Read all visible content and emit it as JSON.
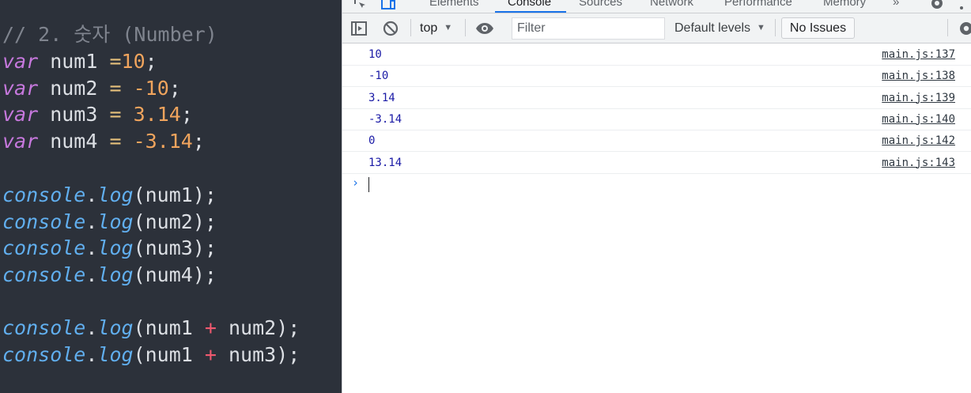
{
  "editor": {
    "lines": [
      {
        "tokens": [
          {
            "t": "comment",
            "v": "// 2. 숫자 (Number)"
          }
        ]
      },
      {
        "tokens": [
          {
            "t": "kw",
            "v": "var"
          },
          {
            "t": "id",
            "v": " num1 "
          },
          {
            "t": "op",
            "v": "="
          },
          {
            "t": "num",
            "v": "10"
          },
          {
            "t": "id",
            "v": ";"
          }
        ]
      },
      {
        "tokens": [
          {
            "t": "kw",
            "v": "var"
          },
          {
            "t": "id",
            "v": " num2 "
          },
          {
            "t": "op",
            "v": "="
          },
          {
            "t": "id",
            "v": " "
          },
          {
            "t": "num",
            "v": "-10"
          },
          {
            "t": "id",
            "v": ";"
          }
        ]
      },
      {
        "tokens": [
          {
            "t": "kw",
            "v": "var"
          },
          {
            "t": "id",
            "v": " num3 "
          },
          {
            "t": "op",
            "v": "="
          },
          {
            "t": "id",
            "v": " "
          },
          {
            "t": "num",
            "v": "3.14"
          },
          {
            "t": "id",
            "v": ";"
          }
        ]
      },
      {
        "tokens": [
          {
            "t": "kw",
            "v": "var"
          },
          {
            "t": "id",
            "v": " num4 "
          },
          {
            "t": "op",
            "v": "="
          },
          {
            "t": "id",
            "v": " "
          },
          {
            "t": "num",
            "v": "-3.14"
          },
          {
            "t": "id",
            "v": ";"
          }
        ]
      },
      {
        "tokens": []
      },
      {
        "tokens": [
          {
            "t": "obj",
            "v": "console"
          },
          {
            "t": "id",
            "v": "."
          },
          {
            "t": "method",
            "v": "log"
          },
          {
            "t": "id",
            "v": "(num1);"
          }
        ]
      },
      {
        "tokens": [
          {
            "t": "obj",
            "v": "console"
          },
          {
            "t": "id",
            "v": "."
          },
          {
            "t": "method",
            "v": "log"
          },
          {
            "t": "id",
            "v": "(num2);"
          }
        ]
      },
      {
        "tokens": [
          {
            "t": "obj",
            "v": "console"
          },
          {
            "t": "id",
            "v": "."
          },
          {
            "t": "method",
            "v": "log"
          },
          {
            "t": "id",
            "v": "(num3);"
          }
        ]
      },
      {
        "tokens": [
          {
            "t": "obj",
            "v": "console"
          },
          {
            "t": "id",
            "v": "."
          },
          {
            "t": "method",
            "v": "log"
          },
          {
            "t": "id",
            "v": "(num4);"
          }
        ]
      },
      {
        "tokens": []
      },
      {
        "tokens": [
          {
            "t": "obj",
            "v": "console"
          },
          {
            "t": "id",
            "v": "."
          },
          {
            "t": "method",
            "v": "log"
          },
          {
            "t": "id",
            "v": "(num1 "
          },
          {
            "t": "op-red",
            "v": "+"
          },
          {
            "t": "id",
            "v": " num2);"
          }
        ]
      },
      {
        "tokens": [
          {
            "t": "obj",
            "v": "console"
          },
          {
            "t": "id",
            "v": "."
          },
          {
            "t": "method",
            "v": "log"
          },
          {
            "t": "id",
            "v": "(num1 "
          },
          {
            "t": "op-red",
            "v": "+"
          },
          {
            "t": "id",
            "v": " num3);"
          }
        ]
      }
    ]
  },
  "devtools": {
    "tabs": [
      {
        "label": "Elements",
        "active": false
      },
      {
        "label": "Console",
        "active": true
      },
      {
        "label": "Sources",
        "active": false
      },
      {
        "label": "Network",
        "active": false
      },
      {
        "label": "Performance",
        "active": false
      },
      {
        "label": "Memory",
        "active": false
      }
    ],
    "more_tabs_label": "»",
    "toolbar": {
      "context_label": "top",
      "filter_placeholder": "Filter",
      "levels_label": "Default levels",
      "issues_label": "No Issues"
    },
    "logs": [
      {
        "value": "10",
        "source": "main.js:137"
      },
      {
        "value": "-10",
        "source": "main.js:138"
      },
      {
        "value": "3.14",
        "source": "main.js:139"
      },
      {
        "value": "-3.14",
        "source": "main.js:140"
      },
      {
        "value": "0",
        "source": "main.js:142"
      },
      {
        "value": "13.14",
        "source": "main.js:143"
      }
    ],
    "prompt_symbol": "›"
  },
  "colors": {
    "editor_bg": "#2c313a",
    "keyword": "#c678dd",
    "number": "#f0a45d",
    "function": "#61afef",
    "console_value": "#1a1aa6",
    "accent": "#1a73e8"
  }
}
